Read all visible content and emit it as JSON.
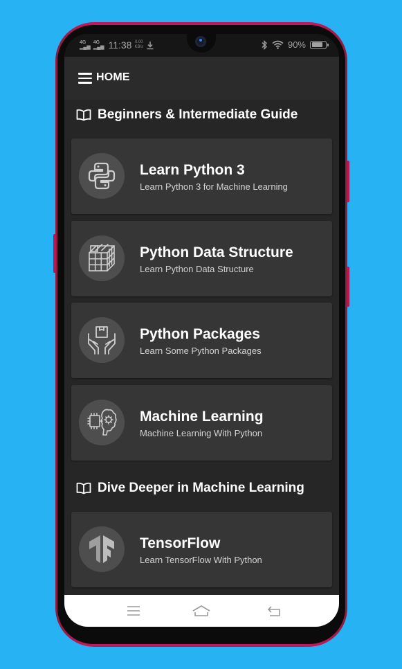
{
  "status_bar": {
    "network_1": "4G",
    "network_2": "4G",
    "time": "11:38",
    "speed_value": "0.00",
    "speed_unit": "KB/s",
    "battery_percent": "90%",
    "battery_level": 0.9
  },
  "app_bar": {
    "title": "HOME"
  },
  "sections": [
    {
      "title": "Beginners & Intermediate Guide",
      "cards": [
        {
          "title": "Learn Python 3",
          "subtitle": "Learn Python 3 for Machine Learning",
          "icon": "python-icon"
        },
        {
          "title": "Python Data Structure",
          "subtitle": "Learn Python Data Structure",
          "icon": "cube-grid-icon"
        },
        {
          "title": "Python Packages",
          "subtitle": "Learn Some Python Packages",
          "icon": "package-hands-icon"
        },
        {
          "title": "Machine Learning",
          "subtitle": "Machine Learning With Python",
          "icon": "brain-chip-icon"
        }
      ]
    },
    {
      "title": "Dive Deeper in Machine Learning",
      "cards": [
        {
          "title": "TensorFlow",
          "subtitle": "Learn TensorFlow With Python",
          "icon": "tensorflow-icon"
        }
      ]
    }
  ],
  "colors": {
    "background": "#27b3f3",
    "screen": "#262626",
    "card": "#363636",
    "frame": "#c2185b"
  }
}
